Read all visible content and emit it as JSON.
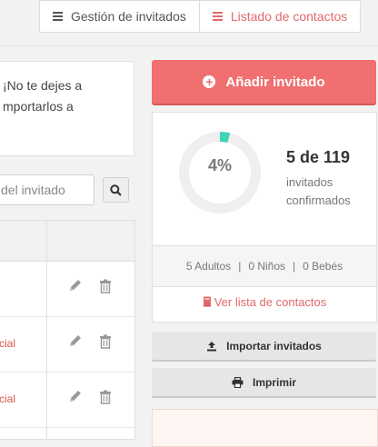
{
  "tabs": [
    {
      "label": "Gestión de invitados",
      "icon": "list-icon",
      "active": false
    },
    {
      "label": "Listado de contactos",
      "icon": "list-icon",
      "active": true
    }
  ],
  "message": {
    "line1": "¡No te dejes a",
    "line2": "mportarlos a"
  },
  "search": {
    "placeholder": "del invitado",
    "button_icon": "search-icon"
  },
  "table": {
    "rows": [
      {
        "social": ""
      },
      {
        "social": "cial"
      },
      {
        "social": "cial"
      }
    ],
    "action_icons": [
      "pencil-icon",
      "trash-icon"
    ]
  },
  "add_guest": {
    "label": "Añadir invitado",
    "icon": "plus-circle-icon"
  },
  "stats": {
    "percent_label": "4%",
    "percent": 4,
    "confirmed_count": "5 de 119",
    "sub_line1": "invitados",
    "sub_line2": "confirmados",
    "breakdown": {
      "adults": "5 Adultos",
      "children": "0 Niños",
      "babies": "0 Bebés",
      "separator": "|"
    },
    "view_contacts": "Ver lista de contactos"
  },
  "import_button": {
    "label": "Importar invitados",
    "icon": "upload-icon"
  },
  "print_button": {
    "label": "Imprimir",
    "icon": "printer-icon"
  },
  "colors": {
    "accent": "#f06f6f",
    "link": "#e26a6a",
    "progress": "#40d3b5",
    "track": "#efefef"
  }
}
